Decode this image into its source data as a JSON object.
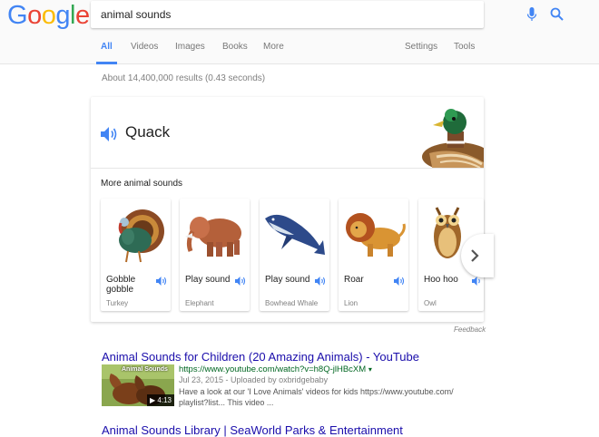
{
  "logo": {
    "letters": [
      "G",
      "o",
      "o",
      "g",
      "l",
      "e"
    ]
  },
  "search": {
    "query": "animal sounds"
  },
  "tabs": [
    {
      "label": "All"
    },
    {
      "label": "Videos"
    },
    {
      "label": "Images"
    },
    {
      "label": "Books"
    },
    {
      "label": "More"
    },
    {
      "label": "Settings"
    },
    {
      "label": "Tools"
    }
  ],
  "results_stats": "About 14,400,000 results (0.43 seconds)",
  "featured": {
    "sound_label": "Quack",
    "more_label": "More animal sounds",
    "animals": [
      {
        "sound": "Gobble gobble",
        "name": "Turkey",
        "icon": "turkey-image"
      },
      {
        "sound": "Play sound",
        "name": "Elephant",
        "icon": "elephant-image"
      },
      {
        "sound": "Play sound",
        "name": "Bowhead Whale",
        "icon": "whale-image"
      },
      {
        "sound": "Roar",
        "name": "Lion",
        "icon": "lion-image"
      },
      {
        "sound": "Hoo hoo",
        "name": "Owl",
        "icon": "owl-image"
      }
    ],
    "feedback": "Feedback"
  },
  "results": [
    {
      "title": "Animal Sounds for Children (20 Amazing Animals) - YouTube",
      "url": "https://www.youtube.com/watch?v=h8Q-jlHBcXM",
      "meta": "Jul 23, 2015 - Uploaded by oxbridgebaby",
      "snippet": "Have a look at our 'I Love Animals' videos for kids https://www.youtube.com/ playlist?list... This video ...",
      "thumb_caption": "Animal Sounds",
      "duration": "4:13"
    },
    {
      "title": "Animal Sounds Library | SeaWorld Parks & Entertainment"
    }
  ],
  "colors": {
    "link": "#1a0dab",
    "url": "#006621",
    "accent": "#4285f4"
  }
}
